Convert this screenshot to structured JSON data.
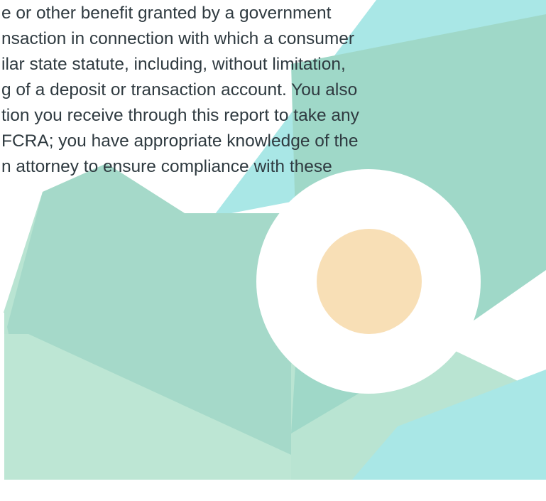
{
  "background": {
    "page_color": "#ffffff",
    "band_color_light": "#b9e4d2",
    "band_color_mid": "#9fd8c8",
    "teal_accent": "#a9e7e6",
    "circle_outer": "#ffffff",
    "circle_inner": "#f8dfb6",
    "bottom_margin_color": "#ffffff"
  },
  "disclaimer_lines": [
    "e or other benefit granted by a government",
    "nsaction in connection with which a consumer",
    "ilar state statute, including, without limitation,",
    "g of a deposit or transaction account. You also",
    "tion you receive through this report to take any",
    "FCRA; you have appropriate knowledge of the",
    "n attorney to ensure compliance with these"
  ]
}
